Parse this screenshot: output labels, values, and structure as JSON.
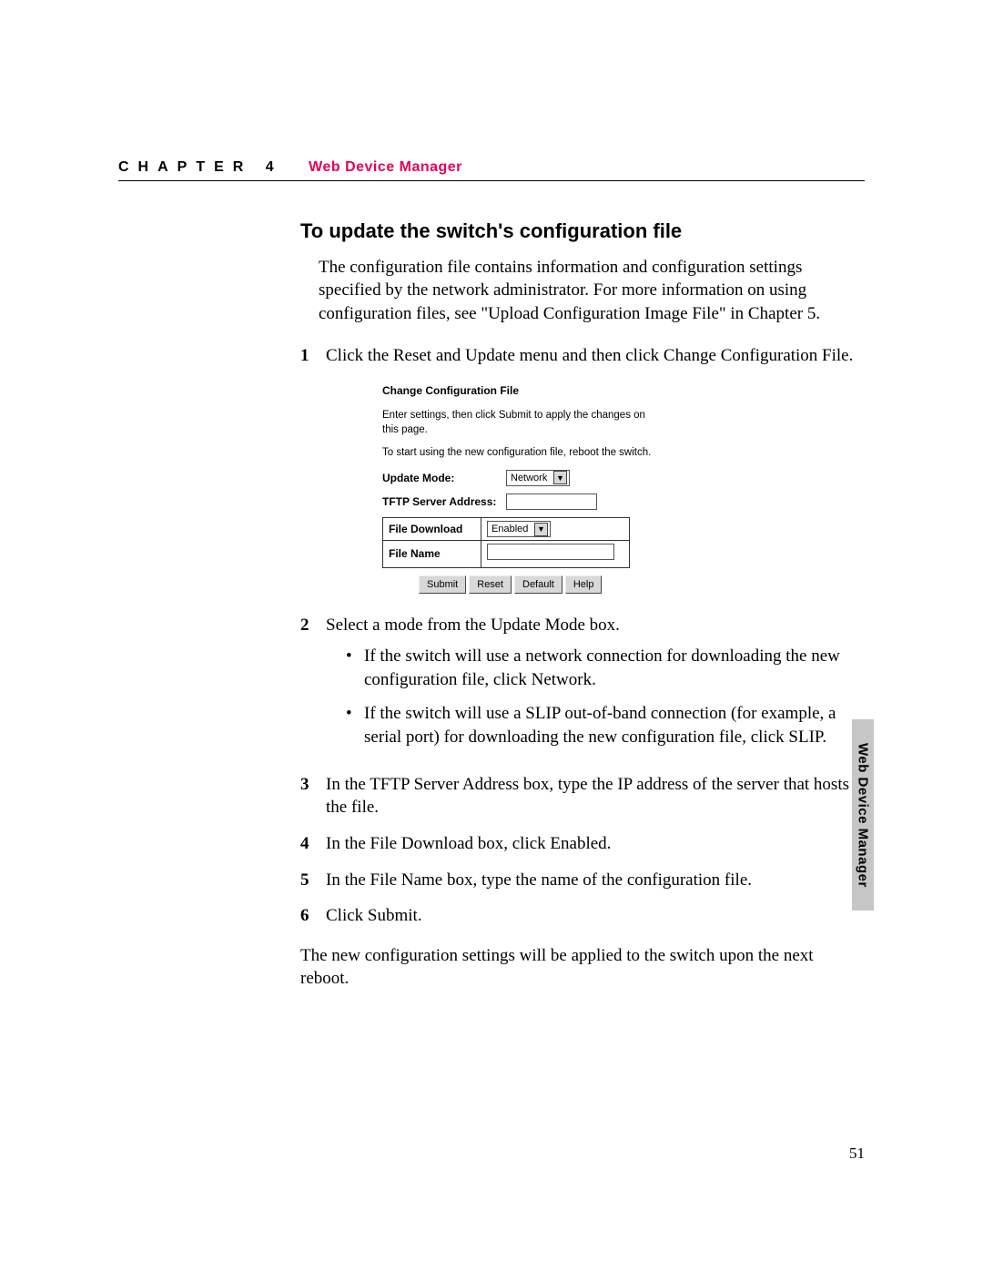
{
  "header": {
    "chapter_prefix": "CHAPTER 4",
    "chapter_title": "Web Device Manager"
  },
  "section": {
    "title": "To update the switch's configuration file",
    "intro": "The configuration file contains information and configuration settings specified by the network administrator. For more information on using configuration files, see \"Upload Configuration Image File\" in Chapter 5.",
    "closing": "The new configuration settings will be applied to the switch upon the next reboot."
  },
  "steps": {
    "s1": {
      "n": "1",
      "t": "Click the Reset and Update menu and then click Change Configuration File."
    },
    "s2": {
      "n": "2",
      "t": "Select a mode from the Update Mode box."
    },
    "s2b1": "If the switch will use a network connection for downloading the new configuration file, click Network.",
    "s2b2": "If the switch will use a SLIP out-of-band connection (for example, a serial port) for downloading the new configuration file, click SLIP.",
    "s3": {
      "n": "3",
      "t": "In the TFTP Server Address box, type the IP address of the server that hosts the file."
    },
    "s4": {
      "n": "4",
      "t": "In the File Download box, click Enabled."
    },
    "s5": {
      "n": "5",
      "t": "In the File Name box, type the name of the configuration file."
    },
    "s6": {
      "n": "6",
      "t": "Click Submit."
    }
  },
  "dialog": {
    "title": "Change Configuration File",
    "line1": "Enter settings, then click Submit to apply the changes on this page.",
    "line2": "To start using the new configuration file, reboot the switch.",
    "labels": {
      "update_mode": "Update Mode:",
      "tftp": "TFTP Server Address:",
      "file_download": "File Download",
      "file_name": "File Name"
    },
    "values": {
      "update_mode": "Network",
      "tftp": "",
      "file_download": "Enabled",
      "file_name": ""
    },
    "buttons": {
      "submit": "Submit",
      "reset": "Reset",
      "default": "Default",
      "help": "Help"
    }
  },
  "side_tab": "Web Device Manager",
  "page_number": "51"
}
